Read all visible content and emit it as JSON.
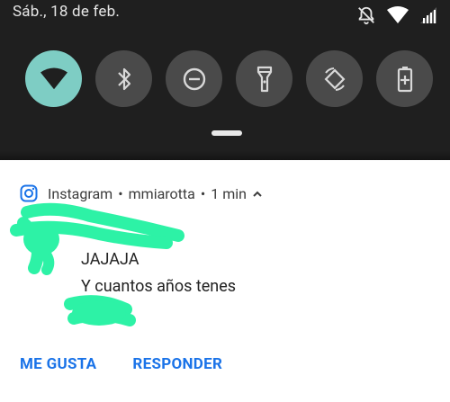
{
  "status_bar": {
    "date": "Sáb., 18 de feb.",
    "icons": [
      "dnd-off-icon",
      "wifi-icon",
      "signal-icon"
    ]
  },
  "quick_tiles": [
    {
      "name": "wifi",
      "icon": "wifi-icon",
      "active": true
    },
    {
      "name": "bluetooth",
      "icon": "bluetooth-icon",
      "active": false
    },
    {
      "name": "do-not-disturb",
      "icon": "minus-circle-icon",
      "active": false
    },
    {
      "name": "flashlight",
      "icon": "flashlight-icon",
      "active": false
    },
    {
      "name": "auto-rotate",
      "icon": "rotate-icon",
      "active": false
    },
    {
      "name": "battery-saver",
      "icon": "battery-plus-icon",
      "active": false
    }
  ],
  "notification": {
    "app": "Instagram",
    "separator": "•",
    "account": "mmiarotta",
    "time": "1 min",
    "title": "JAJAJA",
    "text": "Y cuantos años tenes",
    "actions": {
      "like": "ME GUSTA",
      "reply": "RESPONDER"
    }
  },
  "colors": {
    "shade_bg": "#1f1f1f",
    "tile_active": "#7ecdc4",
    "tile_inactive": "#4a4a4a",
    "action_blue": "#1a73e8",
    "redaction_green": "#2df2a6"
  }
}
